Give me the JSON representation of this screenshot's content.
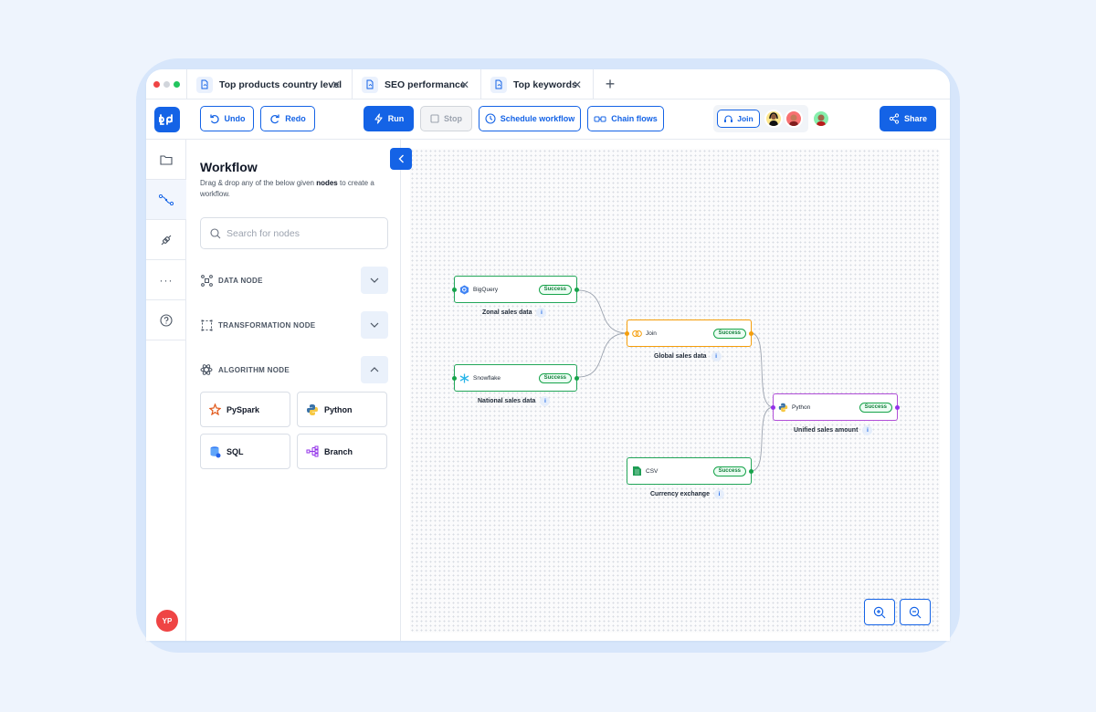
{
  "tabs": [
    {
      "label": "Top products country level"
    },
    {
      "label": "SEO performance"
    },
    {
      "label": "Top keywords"
    }
  ],
  "toolbar": {
    "undo": "Undo",
    "redo": "Redo",
    "run": "Run",
    "stop": "Stop",
    "schedule": "Schedule workflow",
    "chain": "Chain flows",
    "join": "Join",
    "share": "Share"
  },
  "user": {
    "initials": "YP"
  },
  "panel": {
    "title": "Workflow",
    "desc_pre": "Drag & drop any of the below given ",
    "desc_bold": "nodes",
    "desc_post": " to create a workflow.",
    "search_placeholder": "Search for nodes",
    "sections": [
      {
        "label": "DATA NODE",
        "expanded": false
      },
      {
        "label": "TRANSFORMATION NODE",
        "expanded": false
      },
      {
        "label": "ALGORITHM NODE",
        "expanded": true
      }
    ],
    "algorithm_nodes": [
      "PySpark",
      "Python",
      "SQL",
      "Branch"
    ]
  },
  "canvas": {
    "nodes": [
      {
        "type": "BigQuery",
        "status": "Success",
        "label": "Zonal sales data"
      },
      {
        "type": "Snowflake",
        "status": "Success",
        "label": "National sales data"
      },
      {
        "type": "Join",
        "status": "Success",
        "label": "Global sales data"
      },
      {
        "type": "Python",
        "status": "Success",
        "label": "Unified sales amount"
      },
      {
        "type": "CSV",
        "status": "Success",
        "label": "Currency exchange"
      }
    ]
  },
  "colors": {
    "accent": "#1463e6",
    "success": "#16a34a",
    "join_border": "#f59e0b",
    "python_border": "#b14fd8"
  }
}
